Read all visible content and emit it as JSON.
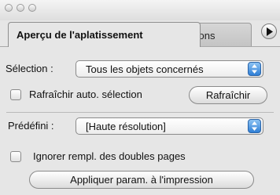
{
  "window": {
    "controls": [
      "close",
      "minimize",
      "zoom"
    ]
  },
  "tabs": [
    {
      "label": "Aperçu de l'aplatissement",
      "active": true
    },
    {
      "label": "tions",
      "active": false
    }
  ],
  "panel_menu_icon": "triangle-right-icon",
  "selection": {
    "label": "Sélection :",
    "value": "Tous les objets concernés"
  },
  "auto_refresh": {
    "label": "Rafraîchir auto. sélection",
    "checked": false
  },
  "refresh_button": {
    "label": "Rafraîchir"
  },
  "preset": {
    "label": "Prédéfini :",
    "value": "[Haute résolution]"
  },
  "ignore_spreads": {
    "label": "Ignorer rempl. des doubles pages",
    "checked": false
  },
  "apply_button": {
    "label": "Appliquer param. à l'impression"
  },
  "colors": {
    "popup_arrow": "#2f7fd6",
    "panel_bg": "#e6e6e6"
  }
}
